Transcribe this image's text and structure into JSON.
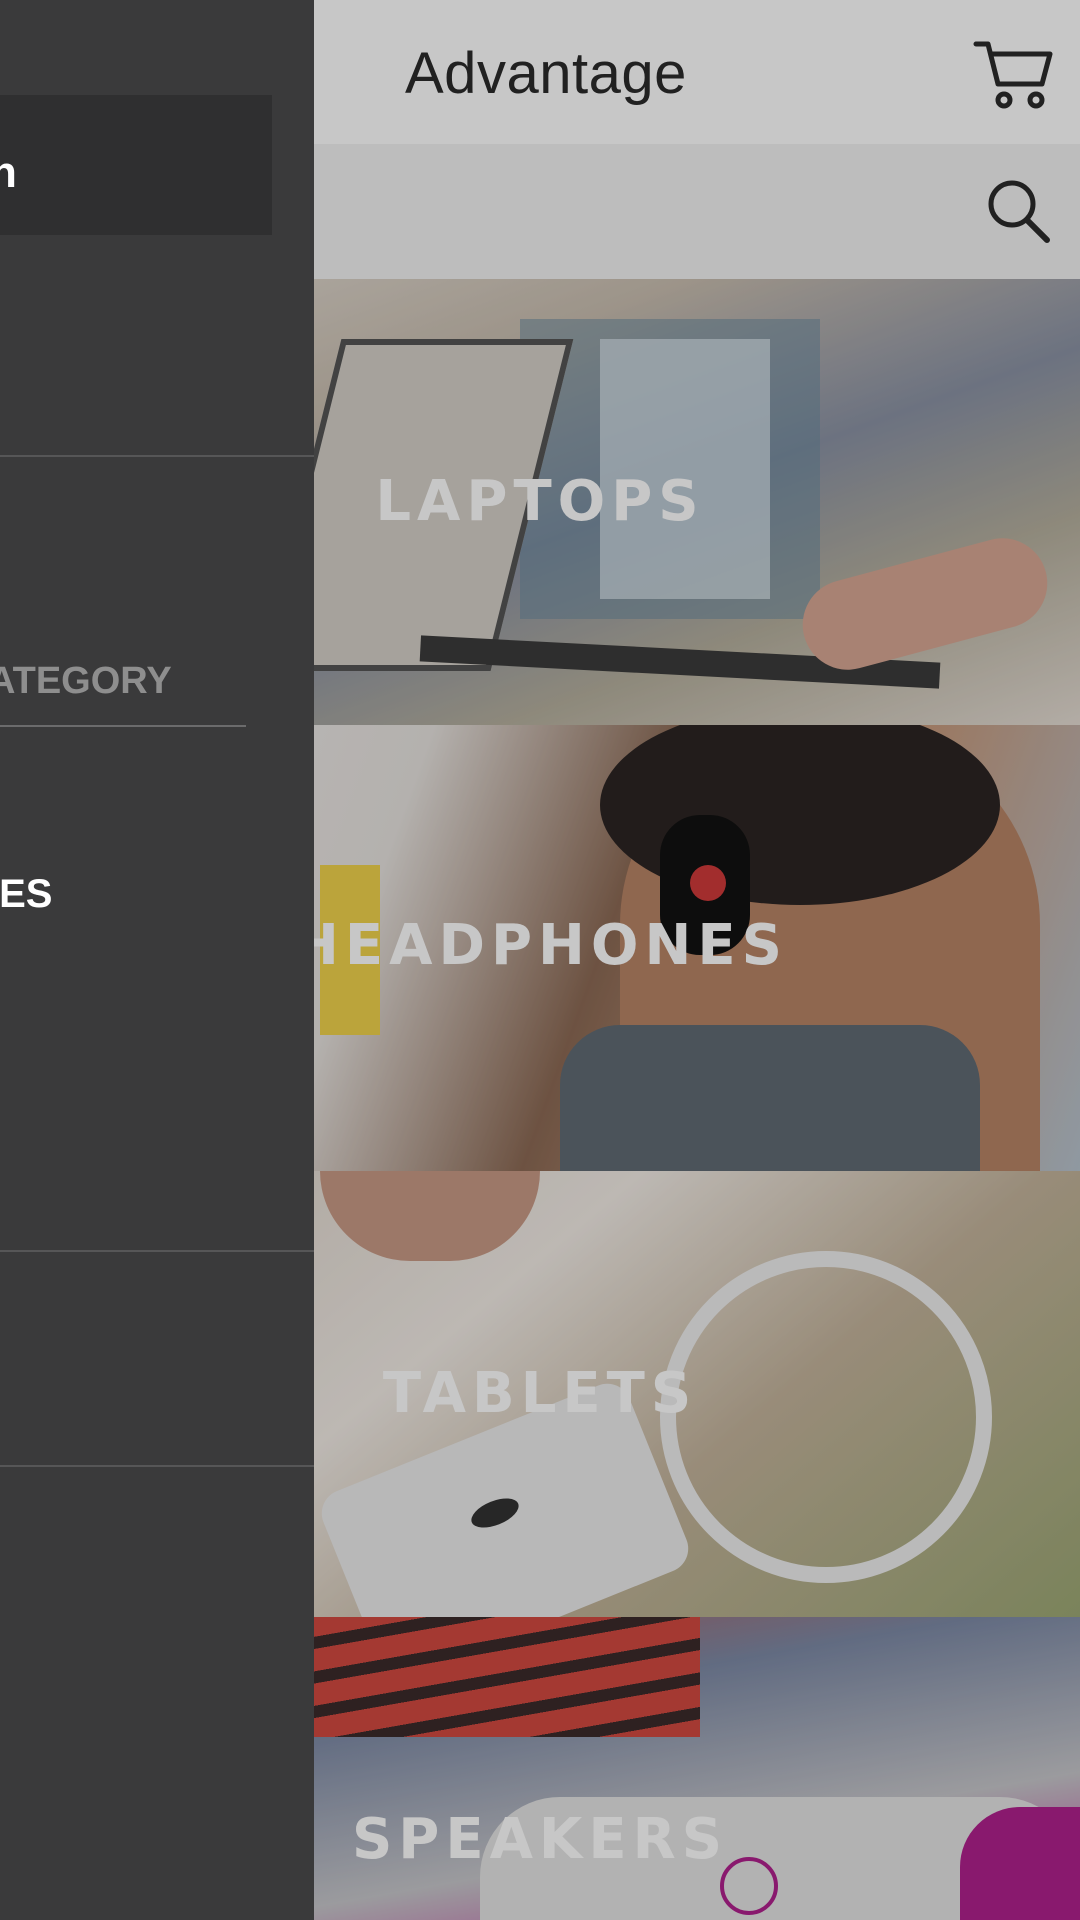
{
  "app": {
    "title": "Advantage"
  },
  "categories": [
    {
      "label": "LAPTOPS"
    },
    {
      "label": "HEADPHONES"
    },
    {
      "label": "TABLETS"
    },
    {
      "label": "SPEAKERS"
    }
  ],
  "drawer": {
    "header_text": "n",
    "category_label": "ATEGORY",
    "selected_item": "IES"
  },
  "icons": {
    "cart": "shopping-cart-icon",
    "search": "search-icon"
  },
  "colors": {
    "drawer_bg": "#3a3a3b",
    "drawer_header_bg": "#2f2f30",
    "topbar_bg": "#ffffff",
    "searchbar_bg": "#f3f3f3"
  }
}
